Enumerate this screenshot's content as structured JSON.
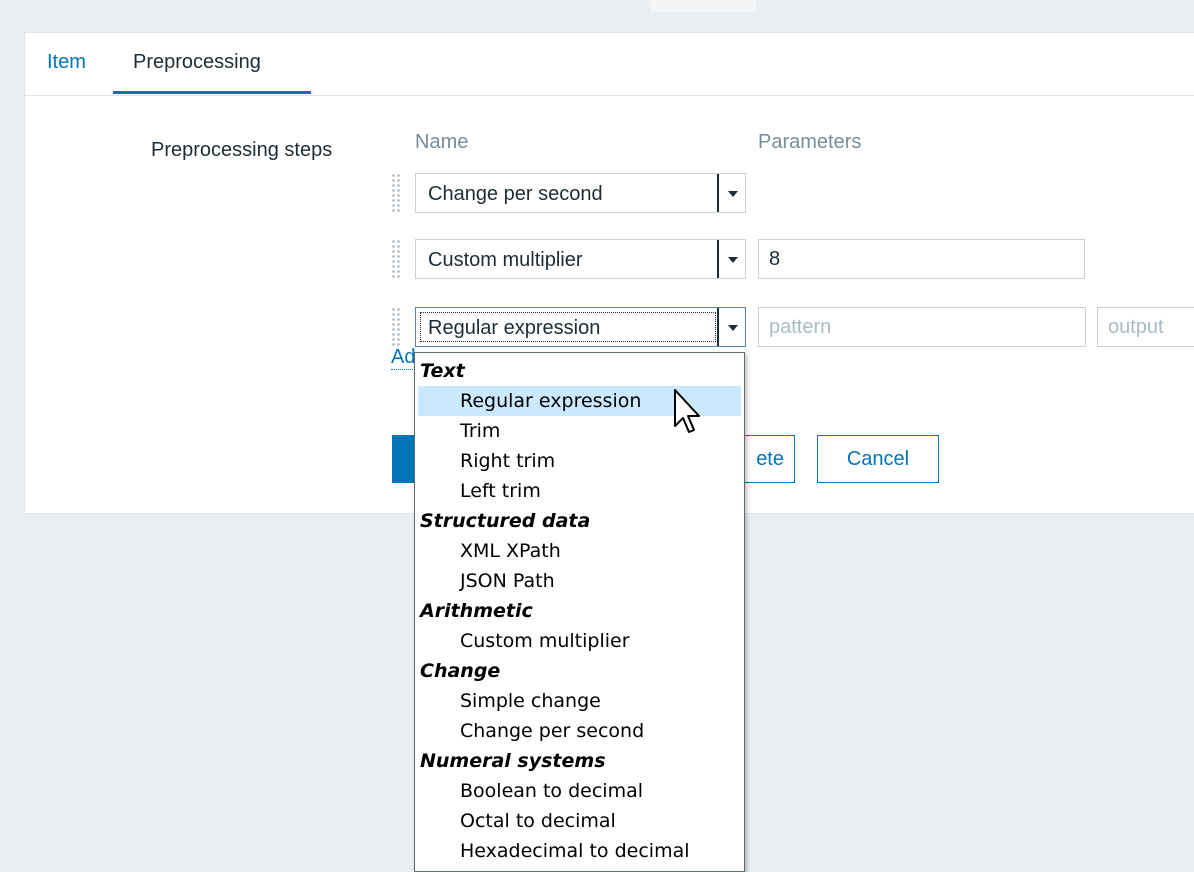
{
  "tabs": [
    {
      "label": "Item"
    },
    {
      "label": "Preprocessing"
    }
  ],
  "form": {
    "steps_label": "Preprocessing steps",
    "columns": {
      "name": "Name",
      "parameters": "Parameters"
    },
    "steps": [
      {
        "name": "Change per second"
      },
      {
        "name": "Custom multiplier",
        "param": "8"
      },
      {
        "name": "Regular expression",
        "pattern_placeholder": "pattern",
        "output_placeholder": "output"
      }
    ],
    "add_link": "Ad"
  },
  "buttons": {
    "primary": "",
    "delete_partial": "ete",
    "cancel": "Cancel"
  },
  "dropdown": {
    "groups": [
      {
        "label": "Text",
        "options": [
          "Regular expression",
          "Trim",
          "Right trim",
          "Left trim"
        ]
      },
      {
        "label": "Structured data",
        "options": [
          "XML XPath",
          "JSON Path"
        ]
      },
      {
        "label": "Arithmetic",
        "options": [
          "Custom multiplier"
        ]
      },
      {
        "label": "Change",
        "options": [
          "Simple change",
          "Change per second"
        ]
      },
      {
        "label": "Numeral systems",
        "options": [
          "Boolean to decimal",
          "Octal to decimal",
          "Hexadecimal to decimal"
        ]
      }
    ],
    "highlighted": "Regular expression"
  },
  "colors": {
    "accent": "#0275b8",
    "highlight": "#cce8ff"
  }
}
